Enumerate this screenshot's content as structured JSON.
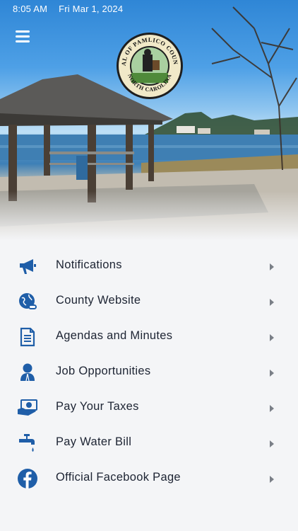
{
  "status_bar": {
    "time": "8:05 AM",
    "date": "Fri Mar 1, 2024"
  },
  "header": {
    "seal_text_top": "SEAL OF PAMLICO COUNTY",
    "seal_text_bottom": "NORTH CAROLINA"
  },
  "menu": {
    "items": [
      {
        "label": "Notifications",
        "icon": "megaphone-icon"
      },
      {
        "label": "County Website",
        "icon": "globe-link-icon"
      },
      {
        "label": "Agendas and Minutes",
        "icon": "document-icon"
      },
      {
        "label": "Job Opportunities",
        "icon": "person-icon"
      },
      {
        "label": "Pay Your Taxes",
        "icon": "money-hand-icon"
      },
      {
        "label": "Pay Water Bill",
        "icon": "faucet-icon"
      },
      {
        "label": "Official Facebook Page",
        "icon": "facebook-icon"
      }
    ]
  },
  "colors": {
    "icon": "#1f5ea8",
    "text": "#1d2433",
    "background": "#f4f5f7",
    "chevron": "#7a7f87"
  }
}
